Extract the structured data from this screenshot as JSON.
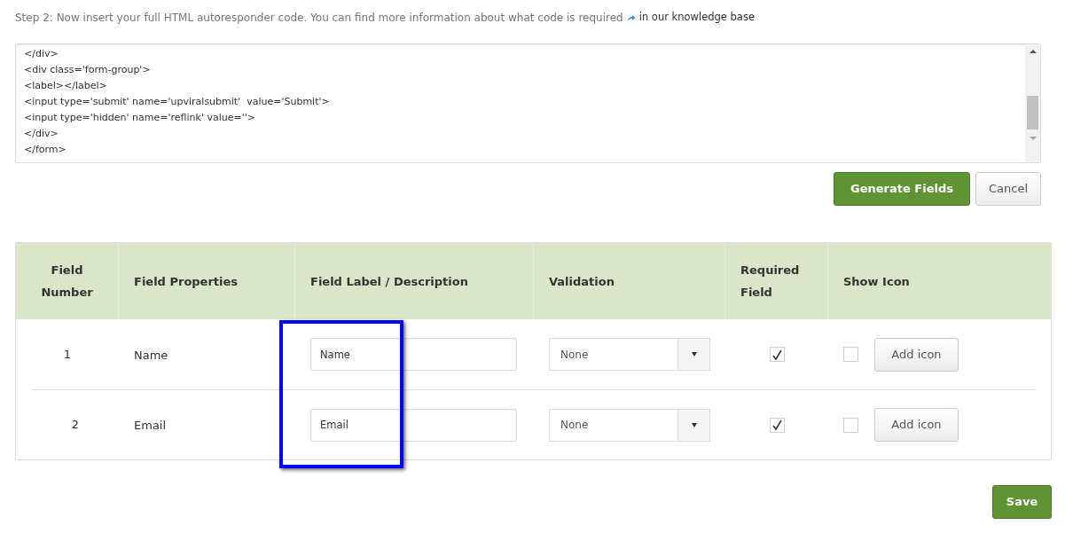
{
  "intro": {
    "text": "Step 2: Now insert your full HTML autoresponder code. You can find more information about what code is required",
    "link": "in our knowledge base"
  },
  "code_lines": [
    "</div>",
    "<div class='form-group'>",
    "<label></label>",
    "<input type='submit' name='upviralsubmit'  value='Submit'>",
    "<input type='hidden' name='reflink' value=''>",
    "</div>",
    "</form>"
  ],
  "actions": {
    "generate": "Generate Fields",
    "cancel": "Cancel"
  },
  "table": {
    "columns": [
      "Field Number",
      "Field Properties",
      "Field Label / Description",
      "Validation",
      "Required Field",
      "Show Icon"
    ],
    "rows": [
      {
        "number": "1",
        "property": "Name",
        "label_value": "Name",
        "validation": "None",
        "required": true,
        "show_icon": false,
        "icon_button": "Add icon"
      },
      {
        "number": "2",
        "property": "Email",
        "label_value": "Email",
        "validation": "None",
        "required": true,
        "show_icon": false,
        "icon_button": "Add icon"
      }
    ]
  },
  "save": "Save"
}
